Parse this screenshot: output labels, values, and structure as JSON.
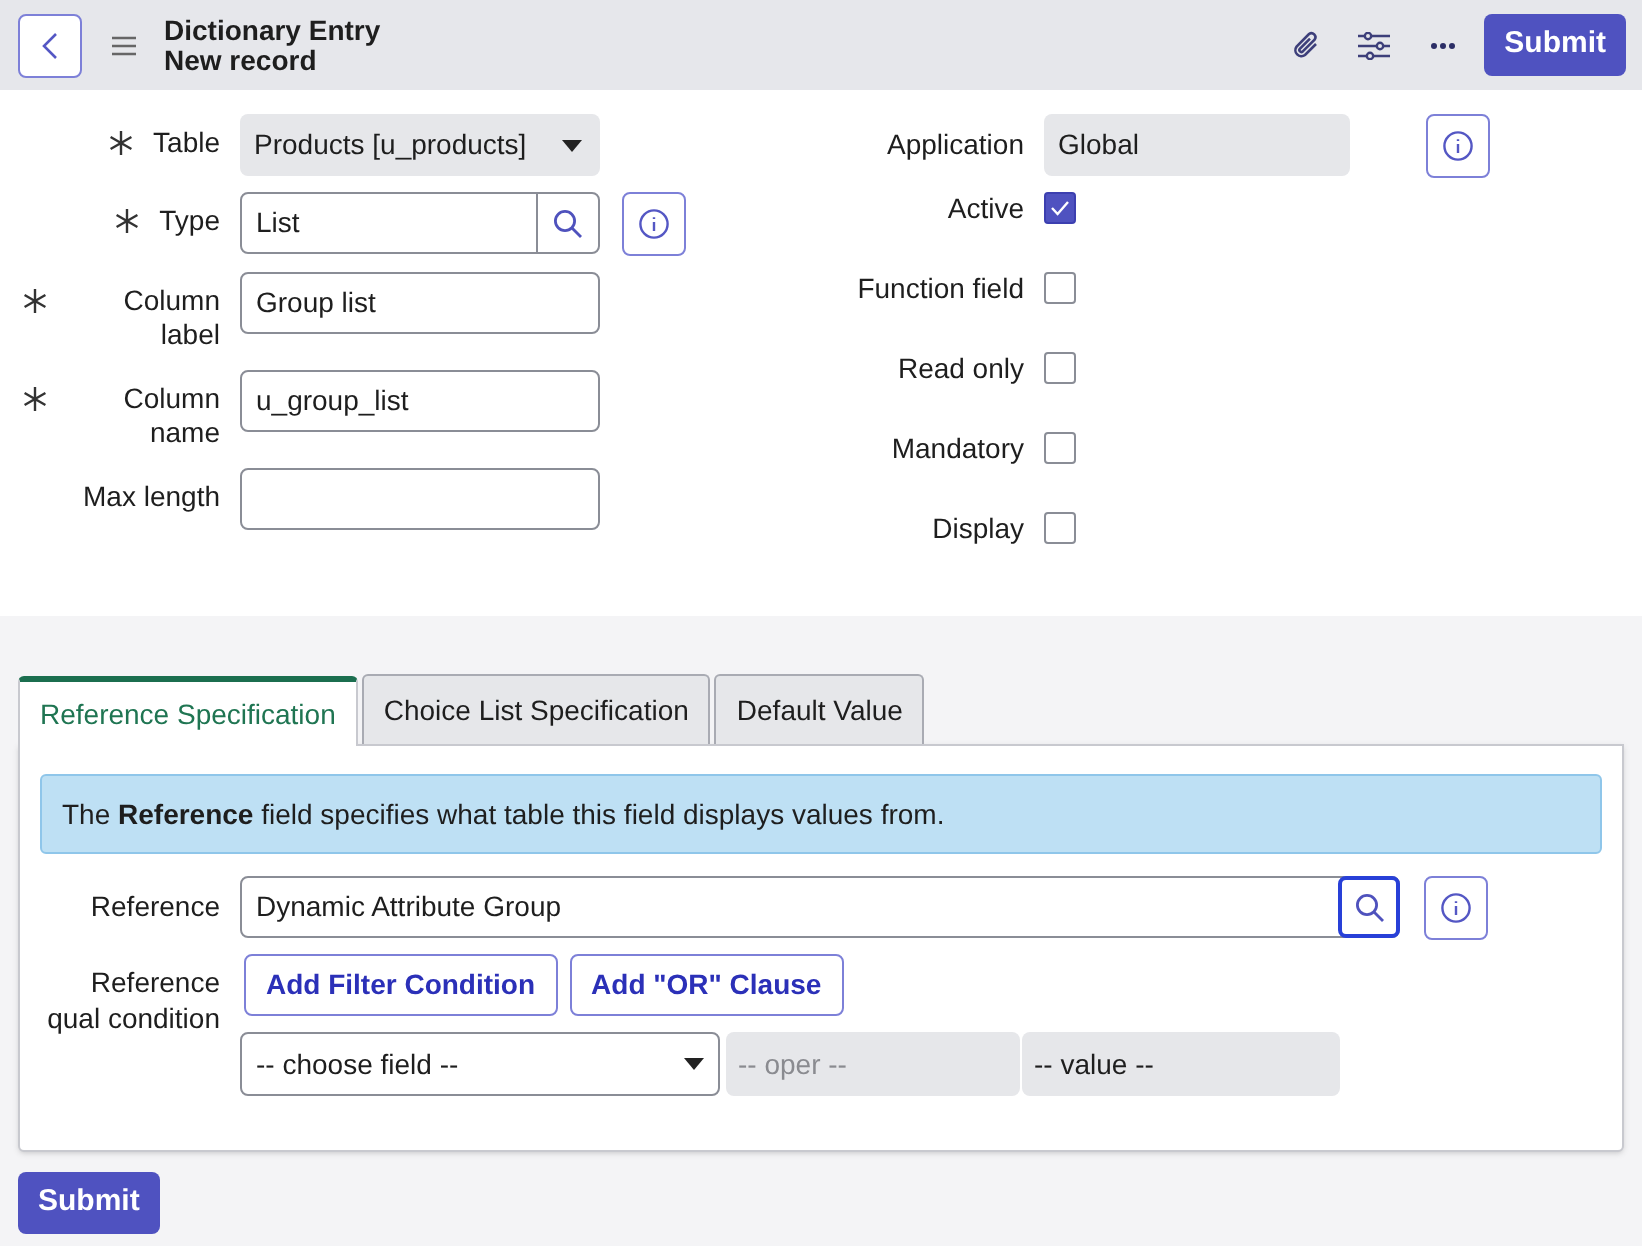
{
  "header": {
    "title": "Dictionary Entry",
    "subtitle": "New record",
    "submit": "Submit"
  },
  "left_fields": [
    {
      "label": "Table",
      "required": true,
      "kind": "select",
      "value": "Products [u_products]",
      "info": false
    },
    {
      "label": "Type",
      "required": true,
      "kind": "lookup",
      "value": "List",
      "info": true
    },
    {
      "label": "Column label",
      "required": true,
      "kind": "text",
      "value": "Group list",
      "info": false
    },
    {
      "label": "Column name",
      "required": true,
      "kind": "text",
      "value": "u_group_list",
      "info": false
    },
    {
      "label": "Max length",
      "required": false,
      "kind": "text",
      "info": false
    }
  ],
  "application": {
    "label": "Application",
    "value": "Global"
  },
  "checkboxes": [
    {
      "label": "Active",
      "checked": true
    },
    {
      "label": "Function field",
      "checked": false
    },
    {
      "label": "Read only",
      "checked": false
    },
    {
      "label": "Mandatory",
      "checked": false
    },
    {
      "label": "Display",
      "checked": false
    }
  ],
  "tabs": [
    {
      "label": "Reference Specification",
      "selected": true
    },
    {
      "label": "Choice List Specification",
      "selected": false
    },
    {
      "label": "Default Value",
      "selected": false
    }
  ],
  "info_banner": "The **Reference** field specifies what table this field displays values from.",
  "reference": {
    "label": "Reference",
    "value": "Dynamic Attribute Group"
  },
  "qual": {
    "label": "Reference qual condition",
    "buttons": [
      "Add Filter Condition",
      "Add \"OR\" Clause"
    ],
    "field_select": "-- choose field --",
    "oper": "-- oper --",
    "value": "-- value --"
  },
  "bottom_submit": "Submit"
}
